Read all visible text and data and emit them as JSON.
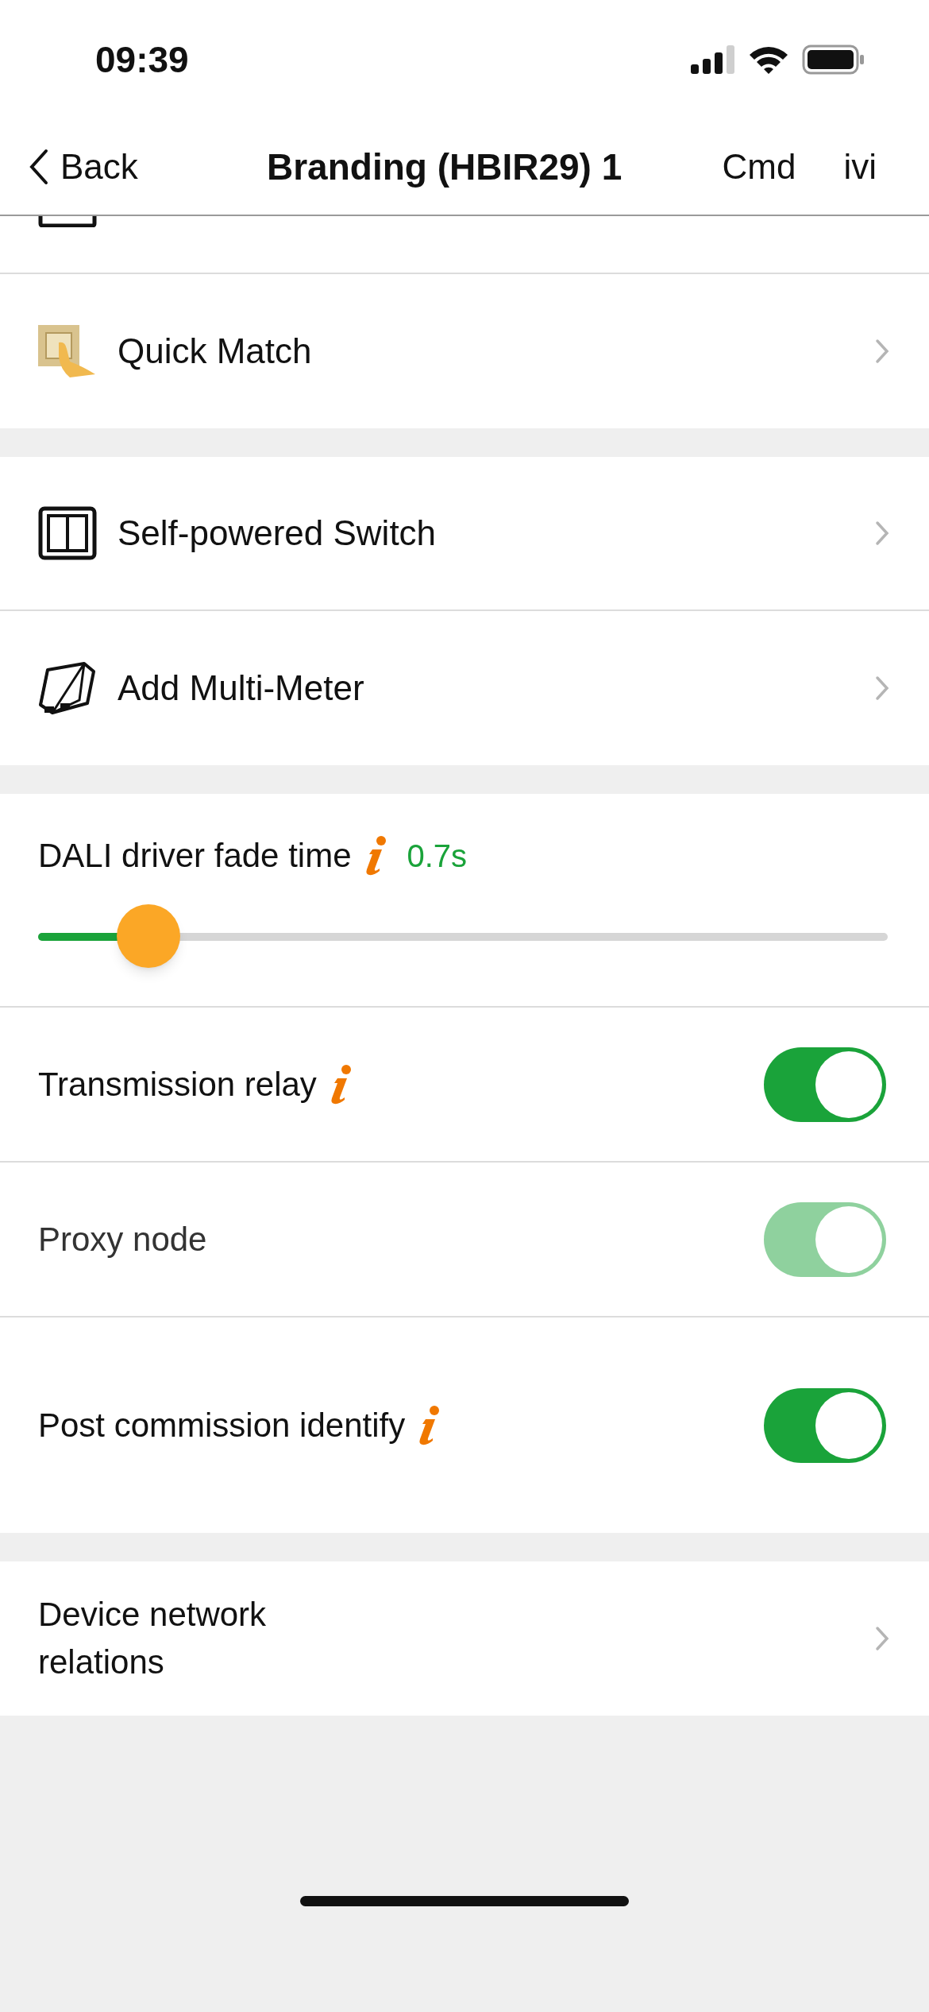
{
  "status_bar": {
    "time": "09:39"
  },
  "nav": {
    "back": "Back",
    "title": "Branding (HBIR29) 1",
    "actions": [
      "Cmd",
      "ivi"
    ]
  },
  "menu_groups": [
    [
      {
        "label": "Quick Match"
      }
    ],
    [
      {
        "label": "Self-powered Switch"
      },
      {
        "label": "Add Multi-Meter"
      }
    ]
  ],
  "fade": {
    "label": "DALI driver fade time",
    "info": true,
    "reading": "0.7s",
    "level": 0.13
  },
  "toggles": [
    {
      "label": "Transmission relay",
      "info": true,
      "on": true,
      "disabled": false
    },
    {
      "label": "Proxy node",
      "info": false,
      "on": true,
      "disabled": true
    },
    {
      "label": "Post commission identify",
      "info": true,
      "on": true,
      "disabled": false
    }
  ],
  "relations": {
    "label": "Device network relations"
  }
}
